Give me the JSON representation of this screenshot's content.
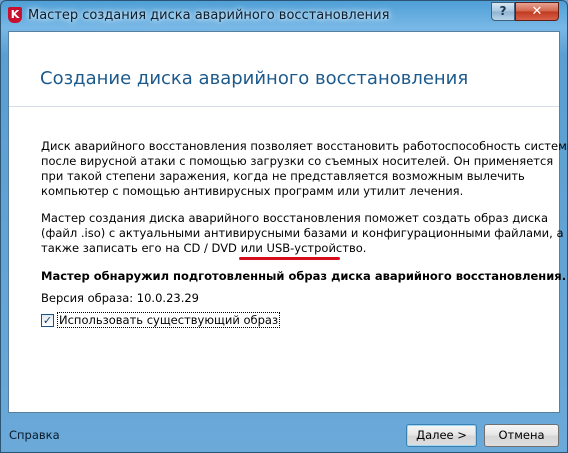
{
  "window": {
    "title": "Мастер создания диска аварийного восстановления",
    "app_icon": "kaspersky-k-icon",
    "help_button": "?",
    "close_button": "✕"
  },
  "main": {
    "heading": "Создание диска аварийного восстановления",
    "paragraph1_lines": [
      "Диск аварийного восстановления позволяет восстановить работоспособность системы",
      "после вирусной атаки с помощью загрузки со съемных носителей. Он применяется",
      "при такой степени заражения, когда не представляется возможным вылечить",
      "компьютер с помощью антивирусных программ или утилит лечения."
    ],
    "paragraph2_lines": [
      "Мастер создания диска аварийного восстановления поможет создать образ диска",
      "(файл .iso) с актуальными антивирусными базами и конфигурационными файлами, а",
      "также записать его на CD / DVD или USB-устройство."
    ],
    "found_text": "Мастер обнаружил подготовленный образ диска аварийного восстановления.",
    "version_text": "Версия образа: 10.0.23.29",
    "use_existing_checkbox": {
      "checked": true,
      "check_mark": "✓",
      "label": "Использовать существующий образ"
    },
    "annotation_color": "#d60e1c"
  },
  "footer": {
    "help_label": "Справка",
    "next_label": "Далее >",
    "cancel_label": "Отмена"
  }
}
